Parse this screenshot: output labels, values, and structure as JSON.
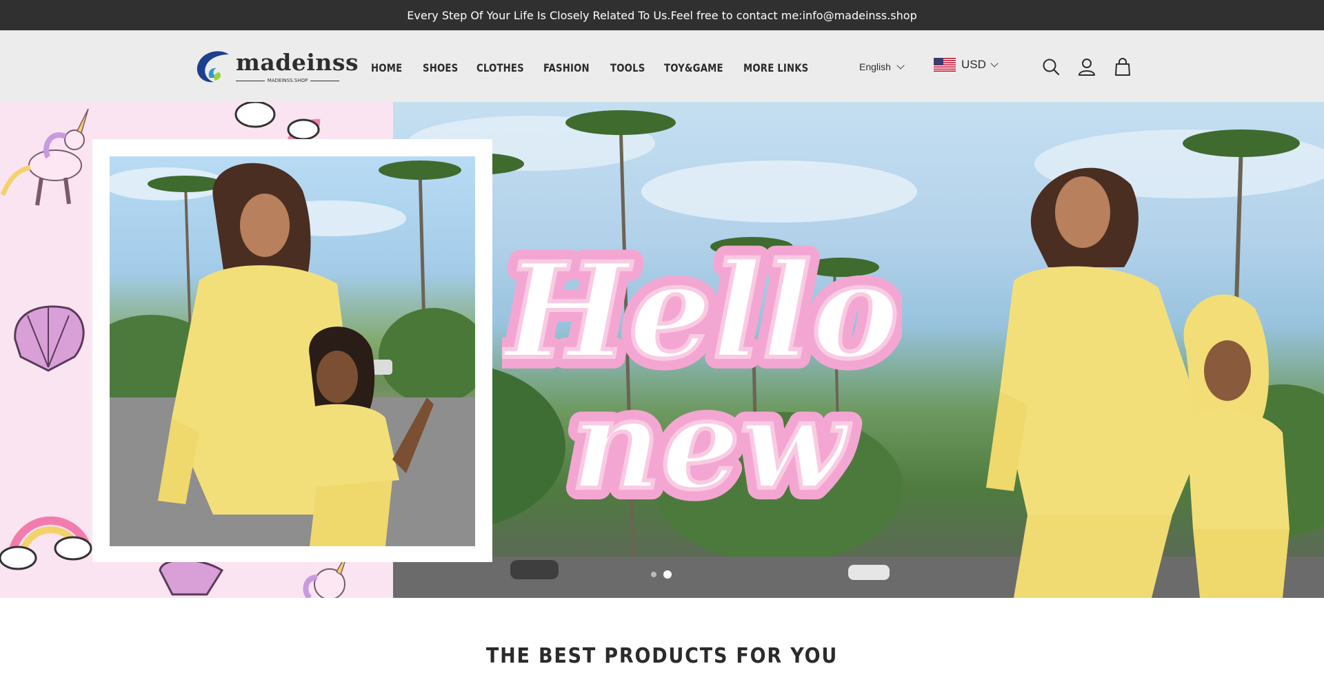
{
  "announcement": {
    "text": "Every Step Of Your Life Is Closely Related To Us.Feel free to contact me:info@madeinss.shop"
  },
  "logo": {
    "name": "madeinss",
    "subtitle": "MADEINSS.SHOP"
  },
  "nav": {
    "items": [
      {
        "label": "HOME"
      },
      {
        "label": "SHOES"
      },
      {
        "label": "CLOTHES"
      },
      {
        "label": "FASHION"
      },
      {
        "label": "TOOLS"
      },
      {
        "label": "TOY&GAME"
      },
      {
        "label": "MORE LINKS"
      }
    ]
  },
  "language": {
    "selected": "English"
  },
  "currency": {
    "selected": "USD",
    "flag": "us-flag-icon"
  },
  "header_icons": [
    "search-icon",
    "user-icon",
    "shopping-bag-icon"
  ],
  "hero": {
    "headline_line1": "Hello",
    "headline_line2": "new",
    "slides": {
      "count": 2,
      "active": 2
    }
  },
  "section": {
    "title": "THE BEST PRODUCTS FOR YOU"
  },
  "colors": {
    "announcement_bg": "#303030",
    "header_bg": "#ececec",
    "hero_left_bg": "#fbe4f1",
    "headline_pink": "#f4a6d2",
    "accent_dark": "#2b2b2b"
  }
}
